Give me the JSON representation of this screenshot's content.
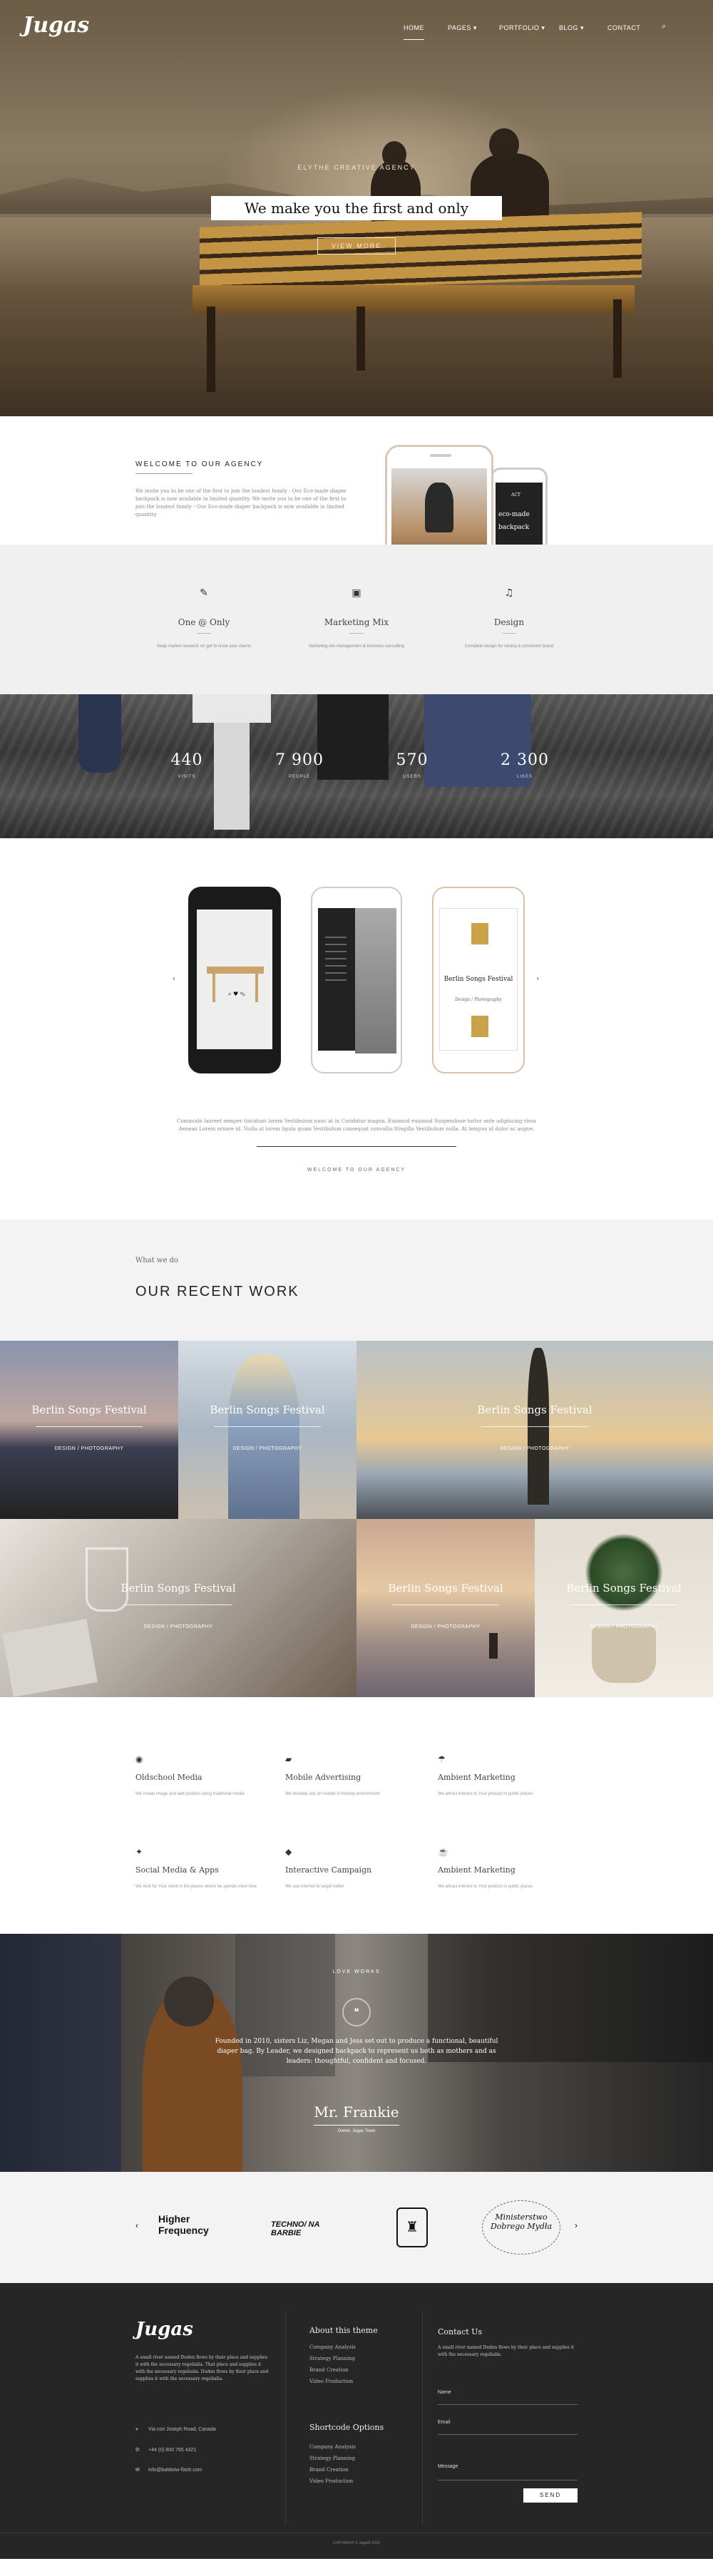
{
  "nav": {
    "logo": "Jugas",
    "items": [
      "HOME",
      "PAGES ▾",
      "PORTFOLIO ▾",
      "BLOG ▾",
      "CONTACT"
    ],
    "search_icon": "search-icon"
  },
  "hero": {
    "kicker": "ELYTHE CREATIVE AGENCY",
    "title": "We make you the first and only",
    "button": "VIEW MORE"
  },
  "welcome": {
    "title": "WELCOME TO OUR AGENCY",
    "text": "We invite you to be one of the first to join the loudest family - Our Eco-made diaper backpack is now available in limited quantity. We invite you to be one of the first to join the loudest family - Our Eco-made diaper backpack is now available in limited quantity.",
    "phone_text_1": "eco-made",
    "phone_text_2": "backpack",
    "phone_text_3": "ACT"
  },
  "features": [
    {
      "icon": "pencil-icon",
      "title": "One @ Only",
      "desc": "Deep market research on get to know your clients"
    },
    {
      "icon": "image-icon",
      "title": "Marketing Mix",
      "desc": "Marketing mix management & business consulting"
    },
    {
      "icon": "music-icon",
      "title": "Design",
      "desc": "Complete design for raising & consistent brand"
    }
  ],
  "counters": [
    {
      "value": "440",
      "label": "VISITS"
    },
    {
      "value": "7 900",
      "label": "PEOPLE"
    },
    {
      "value": "570",
      "label": "USERS"
    },
    {
      "value": "2 300",
      "label": "LIKES"
    }
  ],
  "slider": {
    "prev": "‹",
    "next": "›",
    "phone3_title": "Berlin Songs Festival",
    "phone3_sub": "Design / Photography",
    "text": "Commodo laoreet semper tincidunt lorem Vestibulum nunc at in Curabitur magna. Euismod euismod Suspendisse tortor ante adipiscing risus Aenean Lorem ornare id. Nulla at lorem ligula quam Vestibulum consequat convallis fringilla Vestibulum nulla. At tempus id dolor ac augue.",
    "link": "WELCOME TO OUR AGENCY"
  },
  "work": {
    "small": "What we do",
    "title": "OUR RECENT WORK",
    "tiles": [
      {
        "title": "Berlin Songs Festival",
        "cat": "DESIGN / PHOTOGRAPHY"
      },
      {
        "title": "Berlin Songs Festival",
        "cat": "DESIGN / PHOTOGRAPHY"
      },
      {
        "title": "Berlin Songs Festival",
        "cat": "DESIGN / PHOTOGRAPHY"
      },
      {
        "title": "Berlin Songs Festival",
        "cat": "DESIGN / PHOTOGRAPHY"
      },
      {
        "title": "Berlin Songs Festival",
        "cat": "DESIGN / PHOTOGRAPHY"
      },
      {
        "title": "Berlin Songs Festival",
        "cat": "DESIGN / PHOTOGRAPHY"
      }
    ]
  },
  "services": [
    {
      "icon": "eye-icon",
      "title": "Oldschool Media",
      "desc": "We create image and add position using traditional media"
    },
    {
      "icon": "truck-icon",
      "title": "Mobile Advertising",
      "desc": "We develop ads on mobile in friendly environment"
    },
    {
      "icon": "umbrella-icon",
      "title": "Ambient Marketing",
      "desc": "We attract interest to Your product in public places"
    },
    {
      "icon": "pin-icon",
      "title": "Social Media & Apps",
      "desc": "We look for Your client in the places where he spends most time"
    },
    {
      "icon": "tag-icon",
      "title": "Interactive Campaign",
      "desc": "We use internet to target better"
    },
    {
      "icon": "coffee-icon",
      "title": "Ambient Marketing",
      "desc": "We attract interest to Your product in public places"
    }
  ],
  "testimonial": {
    "kicker": "LOVE WORKS",
    "quote": "Founded in 2010, sisters Liz, Megan and Jess set out to produce a functional, beautiful diaper bag. By Leader, we designed backpack to represent us both as mothers and as leaders: thoughtful, confident and focused.",
    "name": "Mr. Frankie",
    "role": "Owner, Jugas Team"
  },
  "clients": {
    "prev": "‹",
    "next": "›",
    "logos": [
      "Higher Frequency",
      "TECHNO/ NA BARBIE",
      "Ministerstwo Dobrego Mydła"
    ]
  },
  "footer": {
    "logo": "Jugas",
    "text": "A small river named Duden flows by their place and supplies it with the necessary regelialia. That place and supplies it with the necessary regelialia. Duden flows by their place and supplies it with the necessary regelialia.",
    "address": "Via con Joseph Road, Canada",
    "phone": "+44 (0) 800 765 4321",
    "email": "info@baldwiw-flash.com",
    "col1_title": "About this theme",
    "col1_links": [
      "Company Analysis",
      "Strategy Planning",
      "Brand Creation",
      "Video Production"
    ],
    "col2_title": "Shortcode Options",
    "col2_links": [
      "Company Analysis",
      "Strategy Planning",
      "Brand Creation",
      "Video Production"
    ],
    "contact_title": "Contact Us",
    "contact_text": "A small river named Duden flows by their place and supplies it with the necessary regelialia.",
    "name_label": "Name",
    "email_label": "Email",
    "message_label": "Message",
    "send": "SEND",
    "copyright": "COPYRIGHT © Jugas® 2019"
  }
}
